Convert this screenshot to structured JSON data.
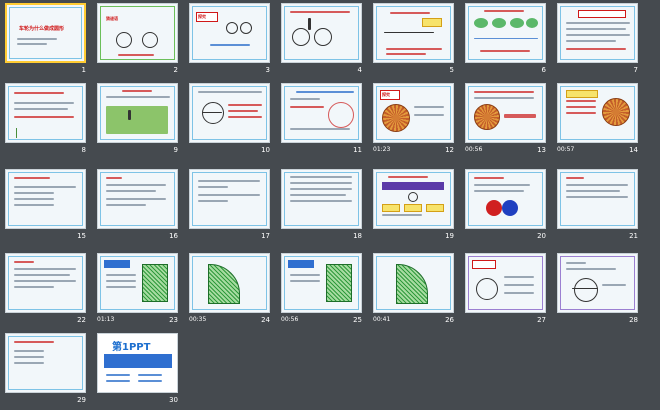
{
  "slides": [
    {
      "number": "1",
      "timing": "",
      "title": "车轮为什么做成圆形"
    },
    {
      "number": "2",
      "timing": "",
      "title": "猜谜语"
    },
    {
      "number": "3",
      "timing": "",
      "title": "探究"
    },
    {
      "number": "4",
      "timing": "",
      "title": ""
    },
    {
      "number": "5",
      "timing": "",
      "title": ""
    },
    {
      "number": "6",
      "timing": "",
      "title": ""
    },
    {
      "number": "7",
      "timing": "",
      "title": ""
    },
    {
      "number": "8",
      "timing": "",
      "title": ""
    },
    {
      "number": "9",
      "timing": "",
      "title": ""
    },
    {
      "number": "10",
      "timing": "",
      "title": ""
    },
    {
      "number": "11",
      "timing": "",
      "title": ""
    },
    {
      "number": "12",
      "timing": "01:23",
      "title": "探究"
    },
    {
      "number": "13",
      "timing": "00:56",
      "title": ""
    },
    {
      "number": "14",
      "timing": "00:57",
      "title": ""
    },
    {
      "number": "15",
      "timing": "",
      "title": ""
    },
    {
      "number": "16",
      "timing": "",
      "title": ""
    },
    {
      "number": "17",
      "timing": "",
      "title": ""
    },
    {
      "number": "18",
      "timing": "",
      "title": ""
    },
    {
      "number": "19",
      "timing": "",
      "title": ""
    },
    {
      "number": "20",
      "timing": "",
      "title": ""
    },
    {
      "number": "21",
      "timing": "",
      "title": ""
    },
    {
      "number": "22",
      "timing": "",
      "title": ""
    },
    {
      "number": "23",
      "timing": "01:13",
      "title": ""
    },
    {
      "number": "24",
      "timing": "00:35",
      "title": ""
    },
    {
      "number": "25",
      "timing": "00:56",
      "title": ""
    },
    {
      "number": "26",
      "timing": "00:41",
      "title": ""
    },
    {
      "number": "27",
      "timing": "",
      "title": ""
    },
    {
      "number": "28",
      "timing": "",
      "title": ""
    },
    {
      "number": "29",
      "timing": "",
      "title": ""
    },
    {
      "number": "30",
      "timing": "",
      "title": "第1PPT"
    }
  ],
  "icons": {
    "timing": "clock-icon"
  },
  "colors": {
    "background": "#454a4f",
    "selection": "#ffcc33",
    "slide_frame": "#7ec3e6"
  }
}
